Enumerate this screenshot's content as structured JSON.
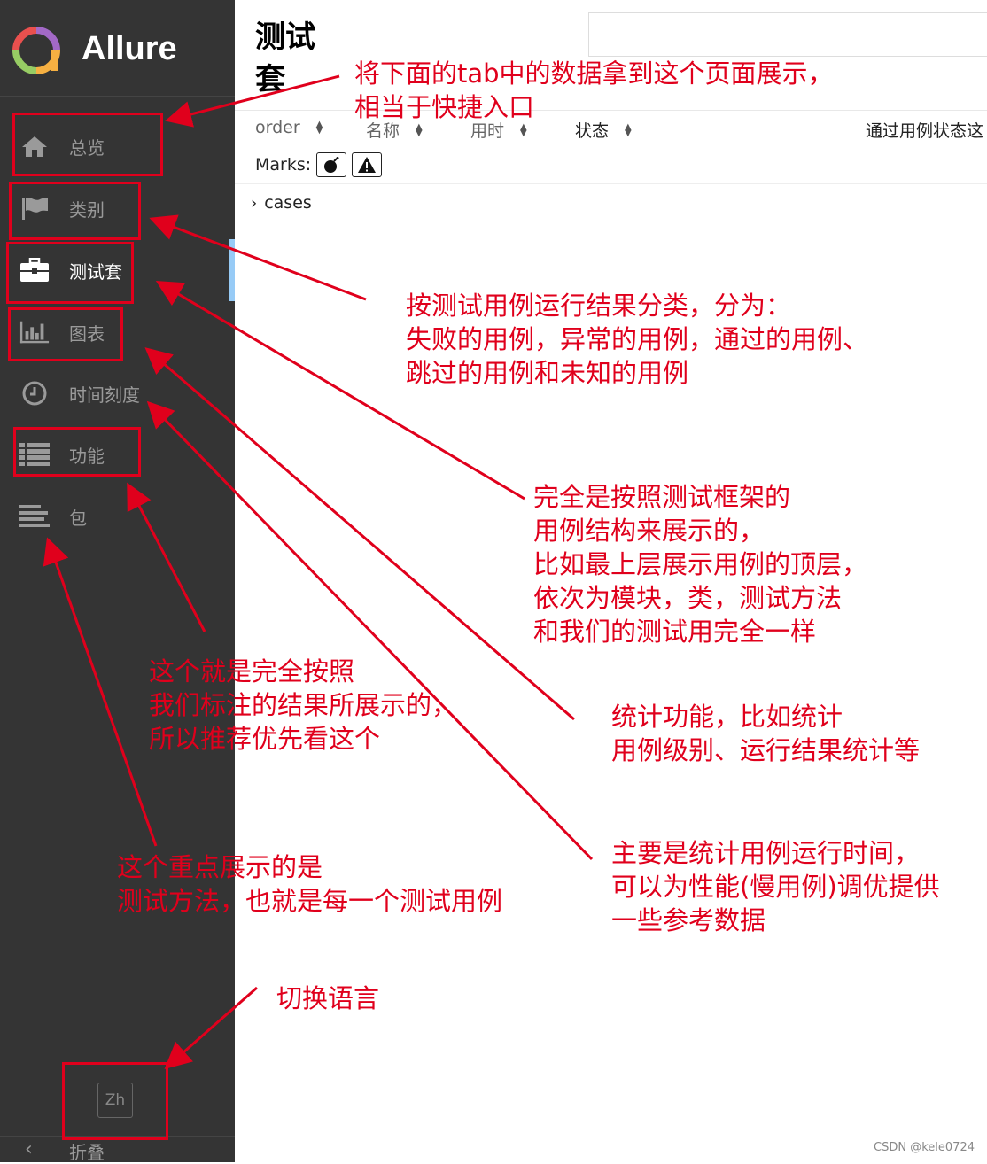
{
  "app": {
    "name": "Allure"
  },
  "sidebar": {
    "items": [
      {
        "label": "总览",
        "icon": "home-icon"
      },
      {
        "label": "类别",
        "icon": "flag-icon"
      },
      {
        "label": "测试套",
        "icon": "briefcase-icon",
        "active": true
      },
      {
        "label": "图表",
        "icon": "bar-chart-icon"
      },
      {
        "label": "时间刻度",
        "icon": "clock-icon"
      },
      {
        "label": "功能",
        "icon": "list-icon"
      },
      {
        "label": "包",
        "icon": "align-left-icon"
      }
    ],
    "language_button": "Zh",
    "collapse_label": "折叠"
  },
  "main": {
    "title": "测试套",
    "columns": [
      "order",
      "名称",
      "用时",
      "状态",
      "通过用例状态这"
    ],
    "marks_label": "Marks:",
    "tree": [
      {
        "label": "cases"
      }
    ]
  },
  "annotations": {
    "tab_data": [
      "将下面的tab中的数据拿到这个页面展示，",
      "相当于快捷入口"
    ],
    "categories": [
      "按测试用例运行结果分类，分为：",
      "失败的用例，异常的用例，通过的用例、",
      "跳过的用例和未知的用例"
    ],
    "suites": [
      "完全是按照测试框架的",
      "用例结构来展示的，",
      "比如最上层展示用例的顶层，",
      "依次为模块，类，测试方法",
      "和我们的测试用完全一样"
    ],
    "graphs": [
      "统计功能，比如统计",
      "用例级别、运行结果统计等"
    ],
    "timeline": [
      "主要是统计用例运行时间，",
      "可以为性能(慢用例)调优提供",
      "一些参考数据"
    ],
    "behaviors": [
      "这个就是完全按照",
      "我们标注的结果所展示的，",
      "所以推荐优先看这个"
    ],
    "packages": [
      "这个重点展示的是",
      "测试方法，也就是每一个测试用例"
    ],
    "language": [
      "切换语言"
    ]
  },
  "watermark": "CSDN @kele0724",
  "colors": {
    "sidebar": "#343434",
    "active": "#97cbf6",
    "annotation": "#e0001c"
  }
}
